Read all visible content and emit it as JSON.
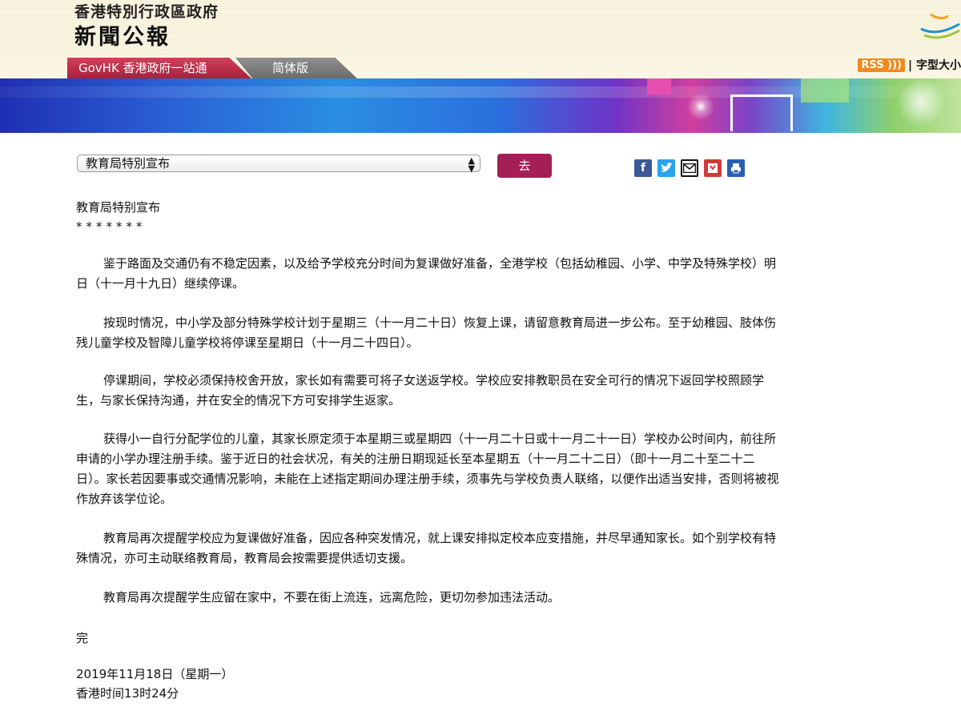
{
  "header": {
    "gov_name": "香港特別行政區政府",
    "press_title": "新聞公報",
    "tabs": {
      "govhk": "GovHK 香港政府一站通",
      "simplified": "简体版"
    },
    "rss_label": "RSS",
    "font_size_label": "| 字型大小"
  },
  "toolbar": {
    "select_value": "教育局特別宣布",
    "go_label": "去",
    "share_icons": [
      "facebook-icon",
      "twitter-icon",
      "email-icon",
      "bookmark-icon",
      "print-icon"
    ]
  },
  "article": {
    "title": "教育局特别宣布",
    "stars": "*******",
    "paragraphs": [
      "鉴于路面及交通仍有不稳定因素，以及给予学校充分时间为复课做好准备，全港学校（包括幼稚园、小学、中学及特殊学校）明日（十一月十九日）继续停课。",
      "按现时情况，中小学及部分特殊学校计划于星期三（十一月二十日）恢复上课，请留意教育局进一步公布。至于幼稚园、肢体伤残儿童学校及智障儿童学校将停课至星期日（十一月二十四日）。",
      "停课期间，学校必须保持校舍开放，家长如有需要可将子女送返学校。学校应安排教职员在安全可行的情况下返回学校照顾学生，与家长保持沟通，并在安全的情况下方可安排学生返家。",
      "获得小一自行分配学位的儿童，其家长原定须于本星期三或星期四（十一月二十日或十一月二十一日）学校办公时间内，前往所申请的小学办理注册手续。鉴于近日的社会状况，有关的注册日期现延长至本星期五（十一月二十二日）（即十一月二十至二十二日）。家长若因要事或交通情况影响，未能在上述指定期间办理注册手续，须事先与学校负责人联络，以便作出适当安排，否则将被视作放弃该学位论。",
      "教育局再次提醒学校应为复课做好准备，因应各种突发情况，就上课安排拟定校本应变措施，并尽早通知家长。如个别学校有特殊情况，亦可主动联络教育局，教育局会按需要提供适切支援。",
      "教育局再次提醒学生应留在家中，不要在街上流连，远离危险，更切勿参加违法活动。"
    ],
    "end_mark": "完",
    "date": "2019年11月18日（星期一）",
    "time": "香港时间13时24分"
  }
}
